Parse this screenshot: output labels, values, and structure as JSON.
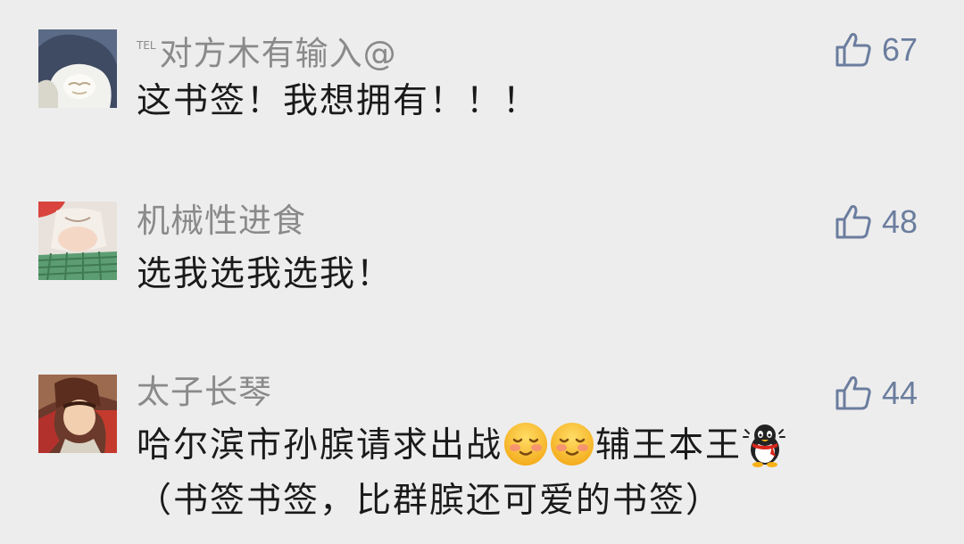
{
  "comments": [
    {
      "tag": "TEL",
      "username": "对方木有输入@",
      "text": "这书签！我想拥有！！！",
      "likes": "67",
      "avatar_icon": "white-hooded-character-avatar"
    },
    {
      "username": "机械性进食",
      "text": "选我选我选我！",
      "likes": "48",
      "avatar_icon": "anime-girl-green-skirt-avatar"
    },
    {
      "username": "太子长琴",
      "text_part1": "哈尔滨市孙膑请求出战",
      "text_part2": "辅王本王",
      "text_line2": "（书签书签，比群膑还可爱的书签）",
      "likes": "44",
      "avatar_icon": "anime-warrior-avatar",
      "emojis": [
        "blush-smile-emoji",
        "blush-smile-emoji",
        "qq-penguin-emoji"
      ]
    }
  ],
  "colors": {
    "background": "#ededed",
    "username": "#8a8a8a",
    "text": "#1a1a1a",
    "like": "#6b7d9e"
  }
}
